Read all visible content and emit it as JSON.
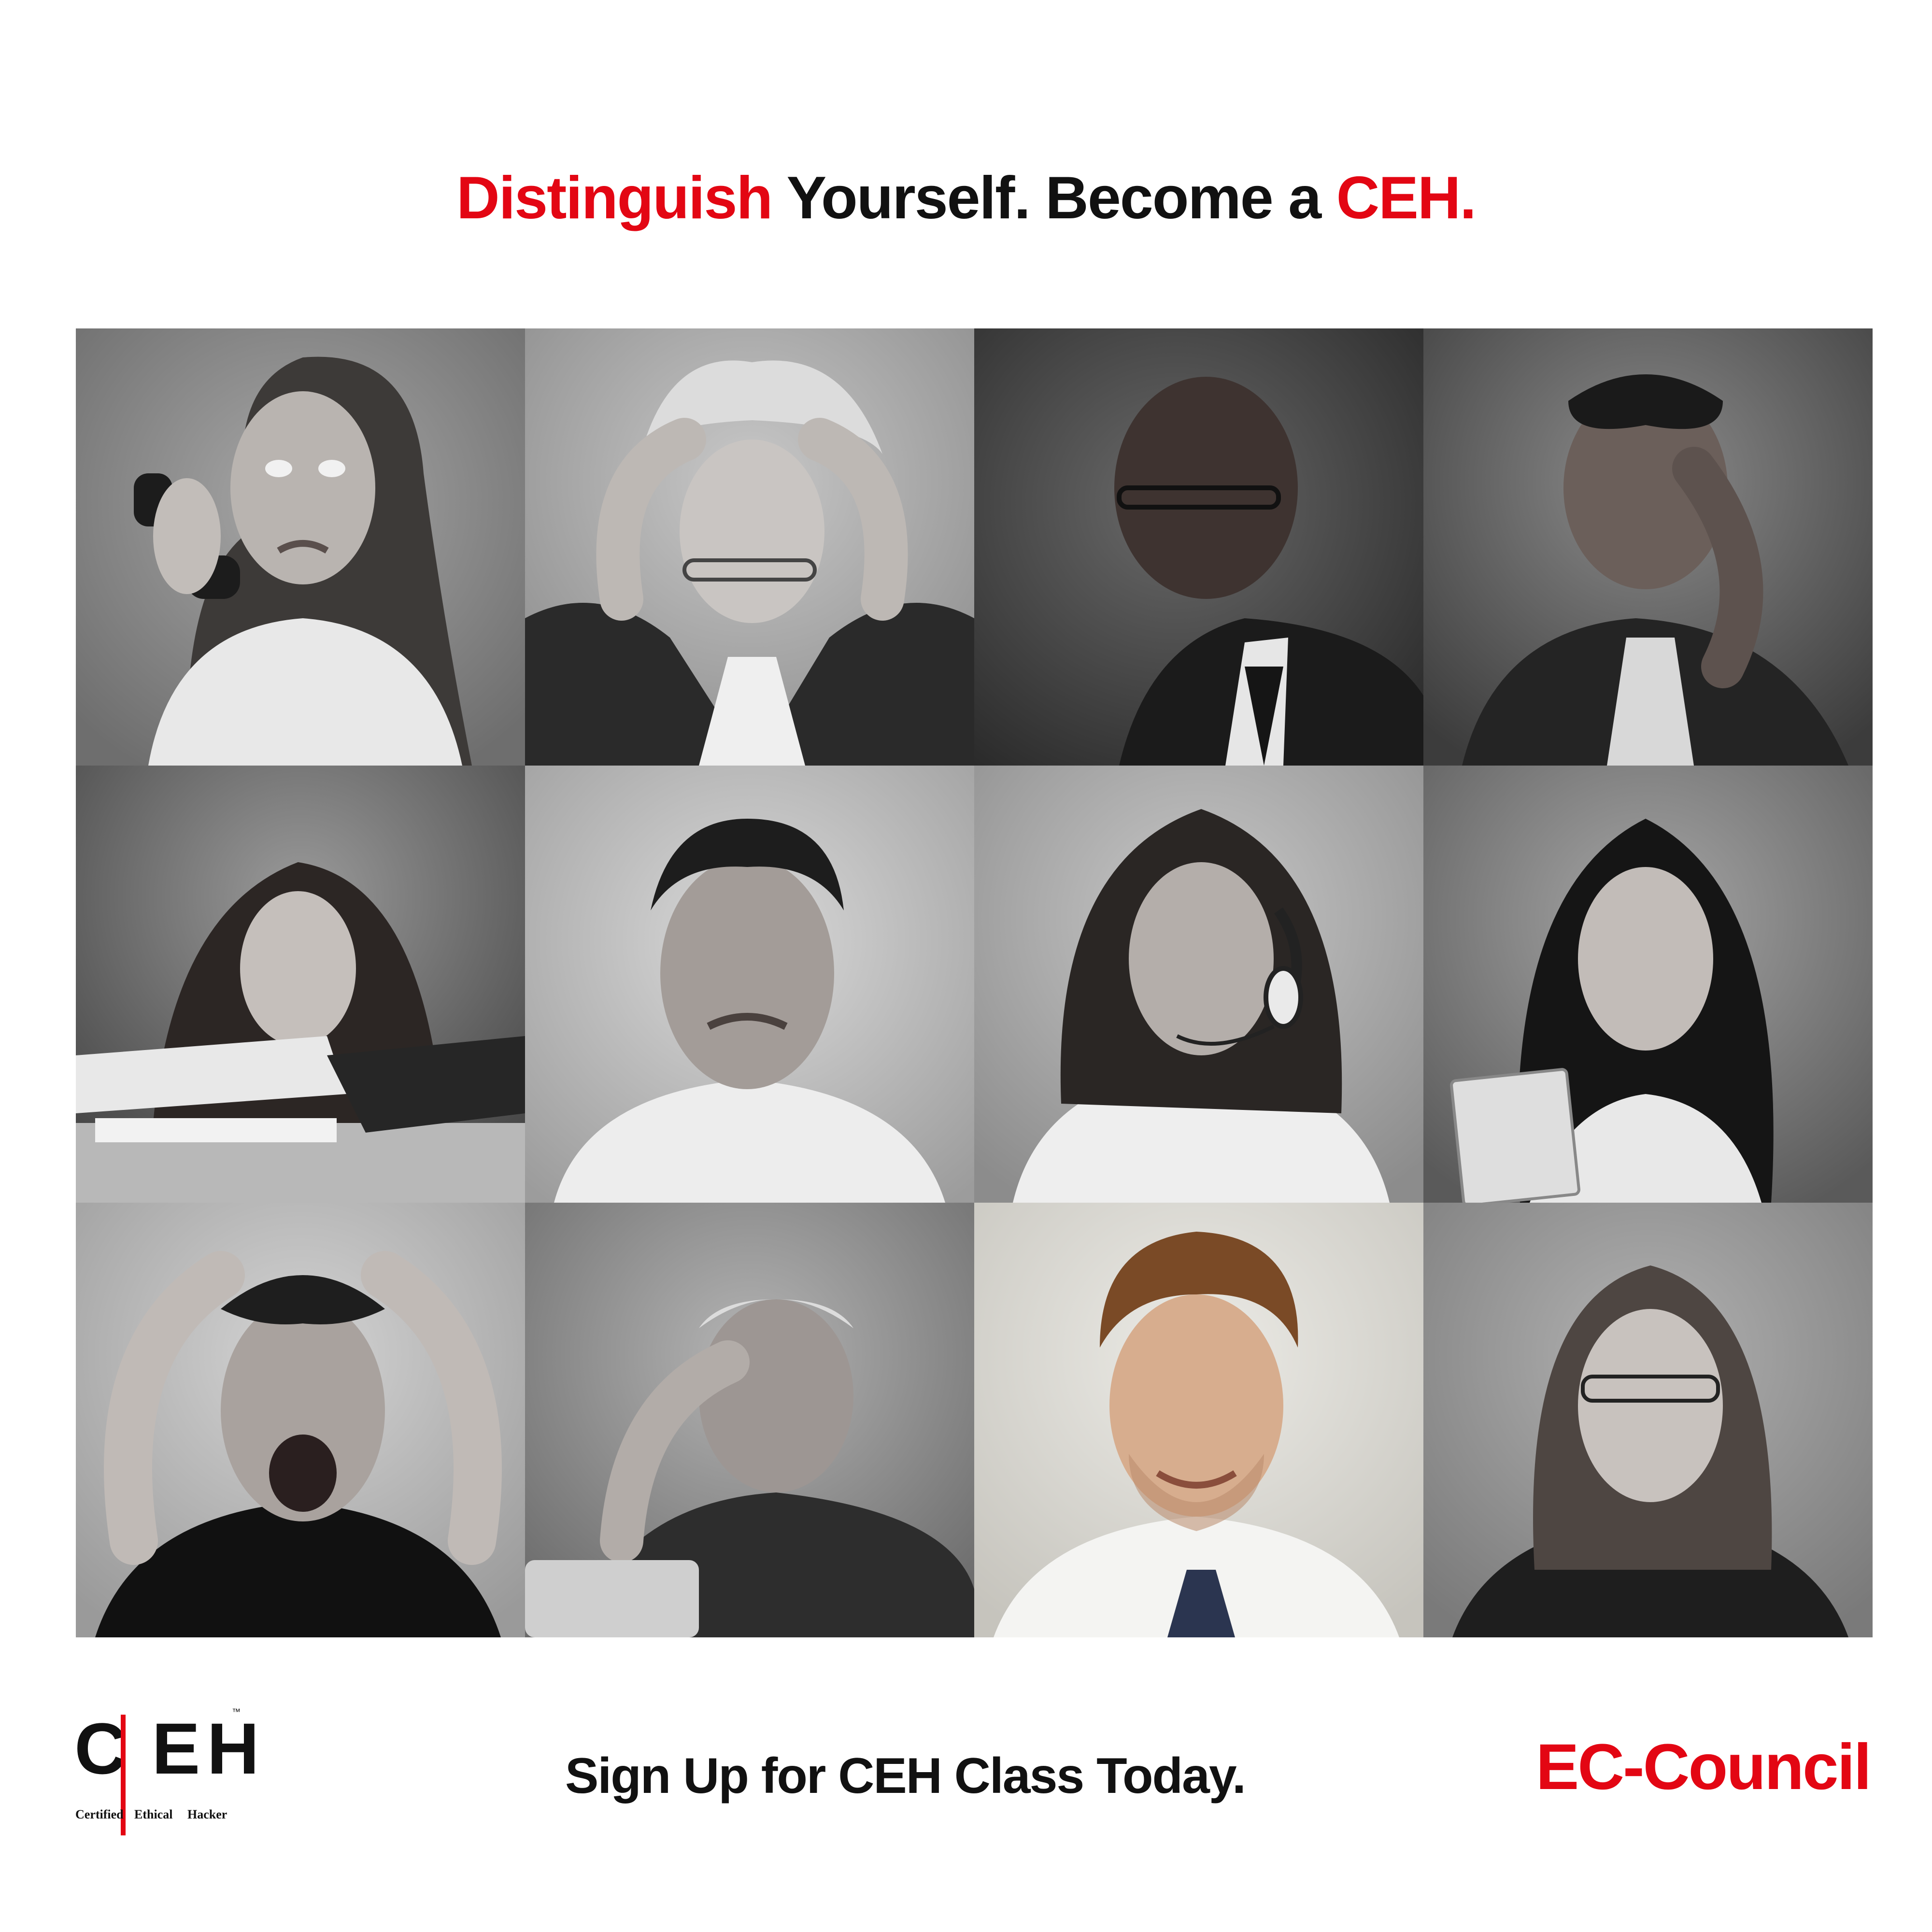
{
  "headline": {
    "word1": "Distinguish",
    "word2": " Yourself. Become a ",
    "word3": "CEH."
  },
  "photos": [
    {
      "id": "frustrated-woman-telephone",
      "color": "grayscale"
    },
    {
      "id": "woman-pulling-hair",
      "color": "grayscale"
    },
    {
      "id": "man-glasses-looking-down",
      "color": "grayscale"
    },
    {
      "id": "man-hand-on-forehead",
      "color": "grayscale"
    },
    {
      "id": "woman-leaning-on-desk",
      "color": "grayscale"
    },
    {
      "id": "man-grimacing",
      "color": "grayscale"
    },
    {
      "id": "woman-headset-pouting",
      "color": "grayscale"
    },
    {
      "id": "woman-holding-money",
      "color": "grayscale"
    },
    {
      "id": "man-screaming-hands-on-head",
      "color": "grayscale"
    },
    {
      "id": "older-man-stressed-laptop",
      "color": "grayscale"
    },
    {
      "id": "smiling-man",
      "color": "color"
    },
    {
      "id": "woman-glasses-pouting",
      "color": "grayscale"
    }
  ],
  "logo": {
    "letter_c": "C",
    "letter_e": "E",
    "letter_h": "H",
    "tm": "™",
    "sub1": "Certified",
    "sub2": "Ethical",
    "sub3": "Hacker"
  },
  "cta": "Sign Up for CEH Class Today.",
  "brand": "EC-Council",
  "colors": {
    "accent_red": "#e30613",
    "text_black": "#111111"
  }
}
